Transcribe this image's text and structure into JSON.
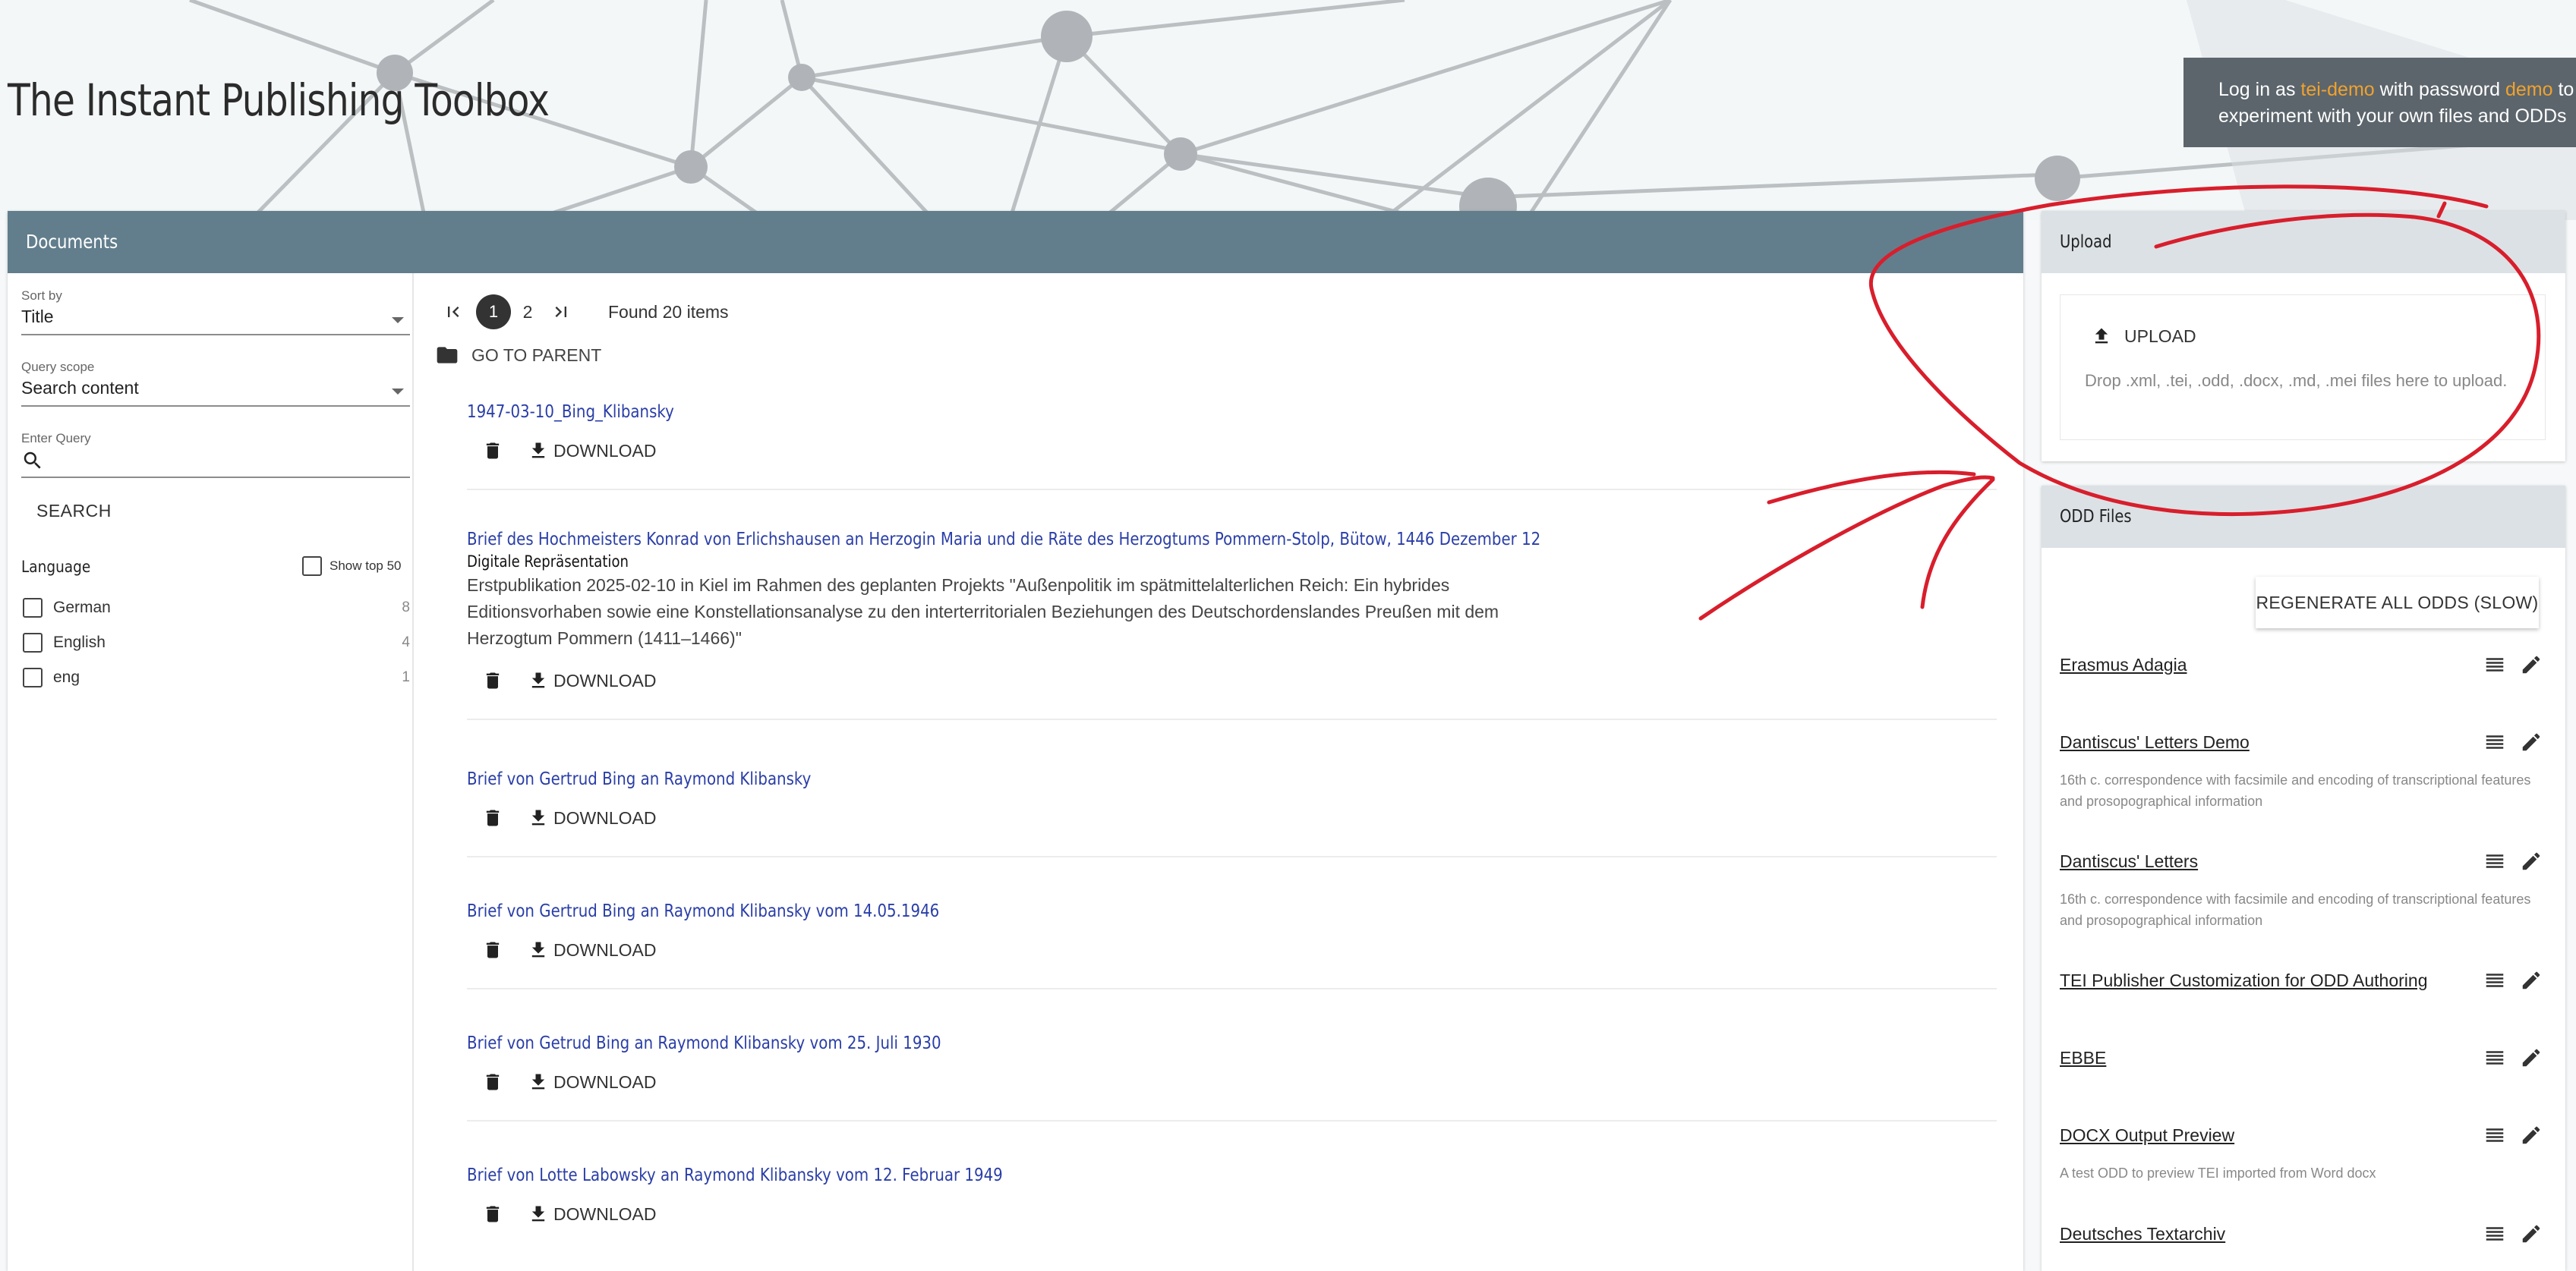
{
  "app": {
    "title": "The Instant Publishing Toolbox",
    "login_hint": {
      "prefix": "Log in as ",
      "user": "tei-demo",
      "middle": " with password ",
      "password": "demo",
      "suffix": " to experiment with your own files and ODDs"
    }
  },
  "documents": {
    "header": "Documents",
    "sort_by": {
      "label": "Sort by",
      "value": "Title"
    },
    "query_scope": {
      "label": "Query scope",
      "value": "Search content"
    },
    "query": {
      "label": "Enter Query",
      "value": ""
    },
    "search_label": "SEARCH",
    "language_facet": {
      "title": "Language",
      "show_top_label": "Show top 50",
      "items": [
        {
          "label": "German",
          "count": "8"
        },
        {
          "label": "English",
          "count": "4"
        },
        {
          "label": "eng",
          "count": "1"
        }
      ]
    },
    "pagination": {
      "pages": [
        "1",
        "2"
      ],
      "current": "1",
      "found": "Found 20 items"
    },
    "go_to_parent": "GO TO PARENT",
    "download_label": "DOWNLOAD",
    "items": [
      {
        "title": "1947-03-10_Bing_Klibansky",
        "subtitle": "",
        "description": ""
      },
      {
        "title": "Brief des Hochmeisters Konrad von Erlichshausen an Herzogin Maria und die Räte des Herzogtums Pommern-Stolp, Bütow, 1446 Dezember 12",
        "subtitle": "Digitale Repräsentation",
        "description": "Erstpublikation 2025-02-10 in Kiel im Rahmen des geplanten Projekts \"Außenpolitik im spätmittelalterlichen Reich: Ein hybrides Editionsvorhaben sowie eine Konstellationsanalyse zu den interterritorialen Beziehungen des Deutschordenslandes Preußen mit dem Herzogtum Pommern (1411–1466)\""
      },
      {
        "title": "Brief von Gertrud Bing an Raymond Klibansky",
        "subtitle": "",
        "description": ""
      },
      {
        "title": "Brief von Gertrud Bing an Raymond Klibansky vom 14.05.1946",
        "subtitle": "",
        "description": ""
      },
      {
        "title": "Brief von Getrud Bing an Raymond Klibansky vom 25. Juli 1930",
        "subtitle": "",
        "description": ""
      },
      {
        "title": "Brief von Lotte Labowsky an Raymond Klibansky vom 12. Februar 1949",
        "subtitle": "",
        "description": ""
      }
    ]
  },
  "upload": {
    "header": "Upload",
    "button_label": "UPLOAD",
    "hint": "Drop .xml, .tei, .odd, .docx, .md, .mei files here to upload."
  },
  "odd_files": {
    "header": "ODD Files",
    "regenerate_label": "REGENERATE ALL ODDS (SLOW)",
    "items": [
      {
        "name": "Erasmus Adagia",
        "description": ""
      },
      {
        "name": "Dantiscus' Letters Demo",
        "description": "16th c. correspondence with facsimile and encoding of transcriptional features and prosopographical information"
      },
      {
        "name": "Dantiscus' Letters",
        "description": "16th c. correspondence with facsimile and encoding of transcriptional features and prosopographical information"
      },
      {
        "name": "TEI Publisher Customization for ODD Authoring",
        "description": ""
      },
      {
        "name": "EBBE",
        "description": ""
      },
      {
        "name": "DOCX Output Preview",
        "description": "A test ODD to preview TEI imported from Word docx"
      },
      {
        "name": "Deutsches Textarchiv",
        "description": ""
      }
    ]
  },
  "colors": {
    "documents_header": "#627e8d",
    "side_header": "#dce1e5",
    "link": "#2a3ea8",
    "login_highlight": "#f0a22d",
    "annotation": "#d81e2c"
  },
  "icons": [
    "first-page-icon",
    "last-page-icon",
    "folder-icon",
    "search-icon",
    "delete-icon",
    "download-icon",
    "upload-icon",
    "list-icon",
    "edit-icon",
    "checkbox-icon",
    "dropdown-arrow-icon"
  ]
}
